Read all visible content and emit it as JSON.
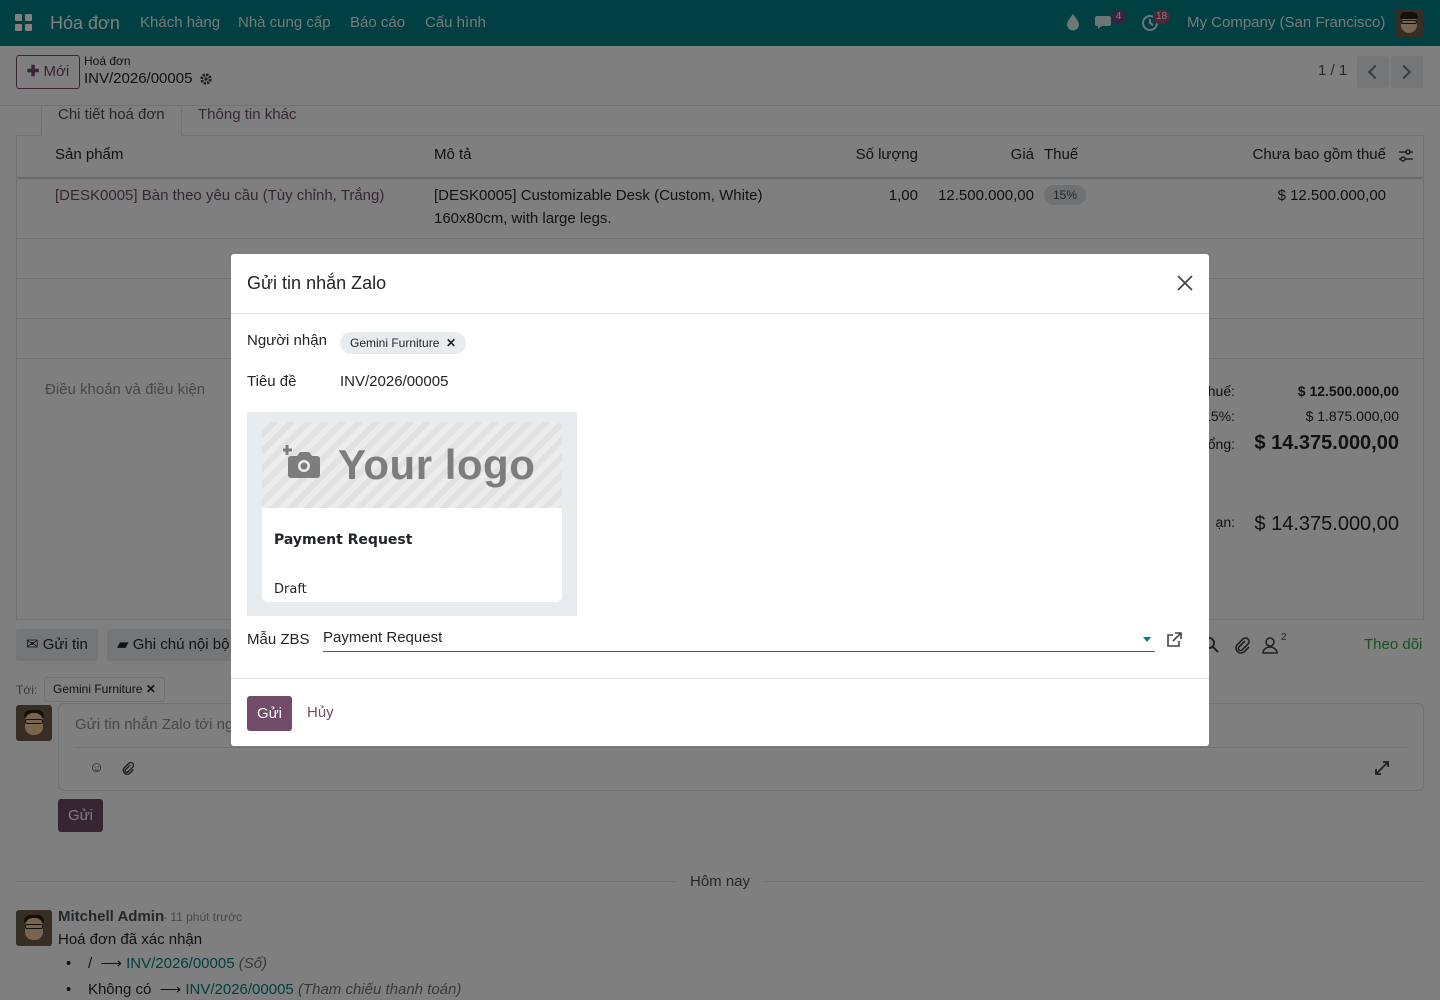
{
  "topbar": {
    "app_title": "Hóa đơn",
    "menu": [
      "Khách hàng",
      "Nhà cung cấp",
      "Báo cáo",
      "Cấu hình"
    ],
    "chat_count": "4",
    "activity_count": "18",
    "company": "My Company (San Francisco)"
  },
  "control_panel": {
    "new_button": "Mới",
    "breadcrumb_parent": "Hoá đơn",
    "record_name": "INV/2026/00005",
    "pager": "1 / 1"
  },
  "tabs": [
    "Chi tiết hoá đơn",
    "Thông tin khác"
  ],
  "lines_table": {
    "headers": {
      "product": "Sản phẩm",
      "description": "Mô tả",
      "quantity": "Số lượng",
      "price": "Giá",
      "tax": "Thuế",
      "subtotal": "Chưa bao gồm thuế"
    },
    "rows": [
      {
        "product": "[DESK0005] Bàn theo yêu cầu (Tùy chỉnh, Trắng)",
        "description_line1": "[DESK0005] Customizable Desk (Custom, White)",
        "description_line2": "160x80cm, with large legs.",
        "quantity": "1,00",
        "price": "12.500.000,00",
        "tax": "15%",
        "subtotal": "$ 12.500.000,00"
      }
    ],
    "terms_placeholder": "Điều khoản và điều kiện"
  },
  "totals": {
    "untaxed_label_fragment": "thuế:",
    "untaxed_value": "$ 12.500.000,00",
    "tax_label_fragment": "15%:",
    "tax_value": "$ 1.875.000,00",
    "total_label_fragment": "ổng:",
    "total_value": "$ 14.375.000,00",
    "due_label_fragment": "ạn:",
    "due_value": "$ 14.375.000,00"
  },
  "chatter": {
    "send_message_button": "Gửi tin",
    "log_note_button": "Ghi chú nội bộ",
    "attachment_count": "",
    "follower_count": "2",
    "follow_button": "Theo dõi",
    "to_label": "Tới:",
    "recipient_tag": "Gemini Furniture",
    "composer_placeholder": "Gửi tin nhắn Zalo tới ng",
    "send_button": "Gửi",
    "date_separator": "Hôm nay",
    "message": {
      "author": "Mitchell Admin",
      "time": "- 11 phút trước",
      "body": "Hoá đơn đã xác nhận",
      "changes": [
        {
          "old": "/",
          "new": "INV/2026/00005",
          "field": "(Số)"
        },
        {
          "old": "Không có",
          "new": "INV/2026/00005",
          "field": "(Tham chiếu thanh toán)"
        }
      ]
    }
  },
  "dialog": {
    "title": "Gửi tin nhắn Zalo",
    "recipient_label": "Người nhận",
    "recipient_tag": "Gemini Furniture",
    "subject_label": "Tiêu đề",
    "subject_value": "INV/2026/00005",
    "preview_logo_text": "Your logo",
    "preview_heading": "Payment Request",
    "preview_status": "Draft",
    "template_label": "Mẫu ZBS",
    "template_value": "Payment Request",
    "send_button": "Gửi",
    "cancel_button": "Hủy"
  },
  "colors": {
    "topbar": "#017e84",
    "primary": "#714b67",
    "link_teal": "#017e84",
    "follow_green": "#28a745"
  }
}
